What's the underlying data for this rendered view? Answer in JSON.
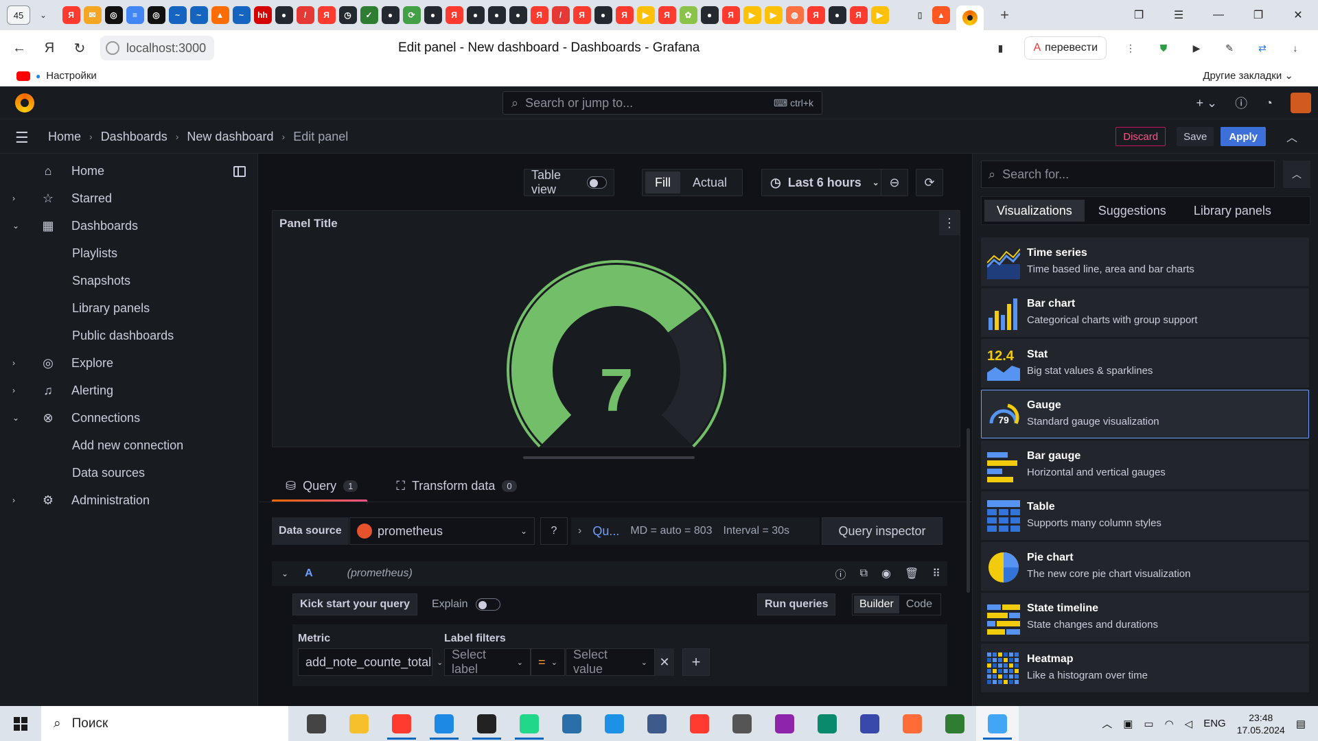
{
  "browser": {
    "tab_count": "45",
    "favicons": [
      {
        "color": "#ff3b30",
        "glyph": "Я"
      },
      {
        "color": "#f5a623",
        "glyph": "✉"
      },
      {
        "color": "#111111",
        "glyph": "◎"
      },
      {
        "color": "#4285f4",
        "glyph": "≡"
      },
      {
        "color": "#111111",
        "glyph": "◎"
      },
      {
        "color": "#1565c0",
        "glyph": "~"
      },
      {
        "color": "#1565c0",
        "glyph": "~"
      },
      {
        "color": "#ff6d00",
        "glyph": "▲"
      },
      {
        "color": "#1565c0",
        "glyph": "~"
      },
      {
        "color": "#d50000",
        "glyph": "hh"
      },
      {
        "color": "#24292f",
        "glyph": "●"
      },
      {
        "color": "#e53935",
        "glyph": "/"
      },
      {
        "color": "#ff3b30",
        "glyph": "Я"
      },
      {
        "color": "#24292f",
        "glyph": "◷"
      },
      {
        "color": "#2e7d32",
        "glyph": "✓"
      },
      {
        "color": "#24292f",
        "glyph": "●"
      },
      {
        "color": "#43a047",
        "glyph": "⟳"
      },
      {
        "color": "#24292f",
        "glyph": "●"
      },
      {
        "color": "#ff3b30",
        "glyph": "Я"
      },
      {
        "color": "#24292f",
        "glyph": "●"
      },
      {
        "color": "#24292f",
        "glyph": "●"
      },
      {
        "color": "#24292f",
        "glyph": "●"
      },
      {
        "color": "#ff3b30",
        "glyph": "Я"
      },
      {
        "color": "#e53935",
        "glyph": "/"
      },
      {
        "color": "#ff3b30",
        "glyph": "Я"
      },
      {
        "color": "#24292f",
        "glyph": "●"
      },
      {
        "color": "#ff3b30",
        "glyph": "Я"
      },
      {
        "color": "#ffc107",
        "glyph": "▶"
      },
      {
        "color": "#ff3b30",
        "glyph": "Я"
      },
      {
        "color": "#8bc34a",
        "glyph": "✿"
      },
      {
        "color": "#24292f",
        "glyph": "●"
      },
      {
        "color": "#ff3b30",
        "glyph": "Я"
      },
      {
        "color": "#ffc107",
        "glyph": "▶"
      },
      {
        "color": "#ffc107",
        "glyph": "▶"
      },
      {
        "color": "#ff7043",
        "glyph": "◍"
      },
      {
        "color": "#ff3b30",
        "glyph": "Я"
      },
      {
        "color": "#24292f",
        "glyph": "●"
      },
      {
        "color": "#ff3b30",
        "glyph": "Я"
      },
      {
        "color": "#ffc107",
        "glyph": "▶"
      }
    ],
    "url": "localhost:3000",
    "page_title": "Edit panel - New dashboard - Dashboards - Grafana",
    "translate_label": "перевести",
    "bookmarks_label": "Настройки",
    "other_bookmarks": "Другие закладки"
  },
  "grafana": {
    "search_placeholder": "Search or jump to...",
    "search_shortcut": "ctrl+k",
    "breadcrumbs": [
      "Home",
      "Dashboards",
      "New dashboard",
      "Edit panel"
    ],
    "discard": "Discard",
    "save": "Save",
    "apply": "Apply",
    "sidebar": [
      {
        "label": "Home",
        "icon": "home-icon",
        "glyph": "⌂",
        "chevron": ""
      },
      {
        "label": "Starred",
        "icon": "star-icon",
        "glyph": "☆",
        "chevron": "›"
      },
      {
        "label": "Dashboards",
        "icon": "apps-icon",
        "glyph": "▦",
        "chevron": "⌄"
      },
      {
        "label": "Playlists",
        "sub": true
      },
      {
        "label": "Snapshots",
        "sub": true
      },
      {
        "label": "Library panels",
        "sub": true
      },
      {
        "label": "Public dashboards",
        "sub": true
      },
      {
        "label": "Explore",
        "icon": "compass-icon",
        "glyph": "◎",
        "chevron": "›"
      },
      {
        "label": "Alerting",
        "icon": "bell-icon",
        "glyph": "♫",
        "chevron": "›"
      },
      {
        "label": "Connections",
        "icon": "link-icon",
        "glyph": "⊗",
        "chevron": "⌄"
      },
      {
        "label": "Add new connection",
        "sub": true
      },
      {
        "label": "Data sources",
        "sub": true
      },
      {
        "label": "Administration",
        "icon": "cog-icon",
        "glyph": "⚙",
        "chevron": "›"
      }
    ],
    "panel_controls": {
      "table_view": "Table view",
      "fill": "Fill",
      "actual": "Actual",
      "time_range": "Last 6 hours"
    },
    "panel": {
      "title": "Panel Title",
      "gauge_value": "7",
      "gauge_fraction": 0.7,
      "gauge_color": "#73bf69"
    },
    "query_tabs": [
      {
        "label": "Query",
        "count": "1"
      },
      {
        "label": "Transform data",
        "count": "0"
      }
    ],
    "query": {
      "data_source_label": "Data source",
      "data_source": "prometheus",
      "options_short": "Qu...",
      "md": "MD = auto = 803",
      "interval": "Interval = 30s",
      "inspector": "Query inspector",
      "ref_id": "A",
      "ds_hint": "(prometheus)",
      "kick_start": "Kick start your query",
      "explain": "Explain",
      "run": "Run queries",
      "builder": "Builder",
      "code": "Code",
      "metric_label": "Metric",
      "metric_value": "add_note_counte_total",
      "label_filters": "Label filters",
      "select_label": "Select label",
      "operator": "=",
      "select_value": "Select value"
    },
    "viz": {
      "search_placeholder": "Search for...",
      "tabs": [
        "Visualizations",
        "Suggestions",
        "Library panels"
      ],
      "items": [
        {
          "name": "Time series",
          "desc": "Time based line, area and bar charts",
          "thumb": "timeseries"
        },
        {
          "name": "Bar chart",
          "desc": "Categorical charts with group support",
          "thumb": "barchart"
        },
        {
          "name": "Stat",
          "desc": "Big stat values & sparklines",
          "thumb": "stat",
          "thumb_text": "12.4"
        },
        {
          "name": "Gauge",
          "desc": "Standard gauge visualization",
          "thumb": "gauge",
          "thumb_text": "79",
          "selected": true
        },
        {
          "name": "Bar gauge",
          "desc": "Horizontal and vertical gauges",
          "thumb": "bargauge"
        },
        {
          "name": "Table",
          "desc": "Supports many column styles",
          "thumb": "table"
        },
        {
          "name": "Pie chart",
          "desc": "The new core pie chart visualization",
          "thumb": "pie"
        },
        {
          "name": "State timeline",
          "desc": "State changes and durations",
          "thumb": "statetimeline"
        },
        {
          "name": "Heatmap",
          "desc": "Like a histogram over time",
          "thumb": "heatmap"
        }
      ]
    }
  },
  "taskbar": {
    "search": "Поиск",
    "apps": [
      {
        "name": "task-view",
        "color": "#444444"
      },
      {
        "name": "file-explorer",
        "color": "#f5c02c"
      },
      {
        "name": "yandex-browser",
        "color": "#ff3b30",
        "open": true
      },
      {
        "name": "vscode",
        "color": "#1e88e5",
        "open": true
      },
      {
        "name": "intellij",
        "color": "#222222",
        "open": true
      },
      {
        "name": "pycharm",
        "color": "#21d789",
        "open": true
      },
      {
        "name": "mysql-workbench",
        "color": "#2a6fa8"
      },
      {
        "name": "docker",
        "color": "#1d91e6"
      },
      {
        "name": "virtualbox",
        "color": "#3d5a8a"
      },
      {
        "name": "yandex",
        "color": "#ff3b30"
      },
      {
        "name": "settings",
        "color": "#555555"
      },
      {
        "name": "winrar",
        "color": "#8e24aa"
      },
      {
        "name": "edge",
        "color": "#0a8a6c"
      },
      {
        "name": "save-tool",
        "color": "#3949ab"
      },
      {
        "name": "postman",
        "color": "#ff6c37"
      },
      {
        "name": "app-green",
        "color": "#2e7d32"
      },
      {
        "name": "photos",
        "color": "#42a5f5",
        "open": true,
        "active": true
      }
    ],
    "lang": "ENG",
    "time": "23:48",
    "date": "17.05.2024"
  }
}
